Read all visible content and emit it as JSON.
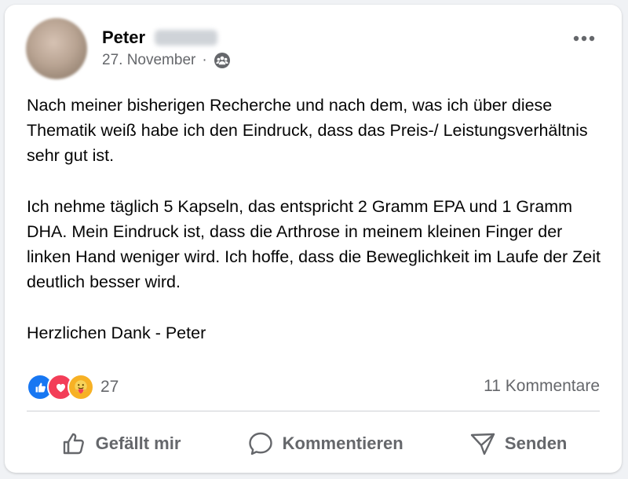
{
  "post": {
    "author_first_name": "Peter",
    "date": "27. November",
    "meta_separator": "·",
    "audience_icon": "friends-icon",
    "more_label": "•••",
    "paragraphs": [
      "Nach meiner bisherigen Recherche und nach dem, was ich über diese Thematik weiß habe ich den Eindruck, dass das Preis-/ Leistungsverhältnis sehr gut ist.",
      "Ich nehme täglich 5 Kapseln, das entspricht 2 Gramm EPA und 1 Gramm DHA. Mein Eindruck ist, dass die Arthrose in meinem kleinen Finger der linken Hand weniger wird. Ich hoffe, dass die Beweglichkeit im Laufe der Zeit deutlich besser wird.",
      "Herzlichen Dank - Peter"
    ]
  },
  "reactions": {
    "icons": [
      "like-icon",
      "love-icon",
      "care-icon"
    ],
    "count": "27"
  },
  "comments": {
    "count_label": "11 Kommentare"
  },
  "actions": {
    "like_label": "Gefällt mir",
    "comment_label": "Kommentieren",
    "send_label": "Senden"
  },
  "colors": {
    "background": "#f0f2f5",
    "card": "#ffffff",
    "secondary_text": "#65676b",
    "like_blue": "#1877f2",
    "love_red": "#f33e58",
    "care_yellow": "#f7b125"
  }
}
